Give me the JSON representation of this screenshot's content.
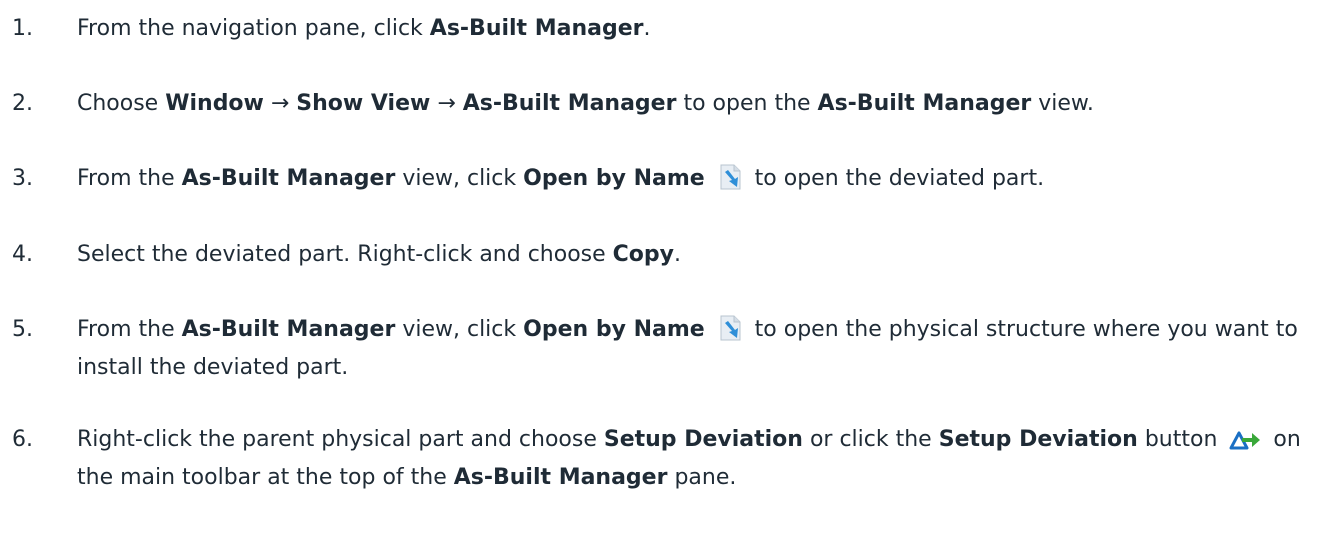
{
  "steps": [
    {
      "number": "1.",
      "parts": [
        {
          "t": "From the navigation pane, click "
        },
        {
          "t": "As-Built Manager",
          "b": true
        },
        {
          "t": "."
        }
      ]
    },
    {
      "number": "2.",
      "parts": [
        {
          "t": "Choose "
        },
        {
          "t": "Window",
          "b": true
        },
        {
          "t": " → "
        },
        {
          "t": "Show View",
          "b": true
        },
        {
          "t": " → "
        },
        {
          "t": "As-Built Manager",
          "b": true
        },
        {
          "t": " to open the "
        },
        {
          "t": "As-Built Manager",
          "b": true
        },
        {
          "t": " view."
        }
      ]
    },
    {
      "number": "3.",
      "parts": [
        {
          "t": "From the "
        },
        {
          "t": "As-Built Manager",
          "b": true
        },
        {
          "t": " view, click "
        },
        {
          "t": "Open by Name",
          "b": true
        },
        {
          "t": " "
        },
        {
          "icon": "open-by-name-icon"
        },
        {
          "t": " to open the deviated part."
        }
      ]
    },
    {
      "number": "4.",
      "parts": [
        {
          "t": "Select the deviated part. Right-click and choose "
        },
        {
          "t": "Copy",
          "b": true
        },
        {
          "t": "."
        }
      ]
    },
    {
      "number": "5.",
      "parts": [
        {
          "t": "From the "
        },
        {
          "t": "As-Built Manager",
          "b": true
        },
        {
          "t": " view, click "
        },
        {
          "t": "Open by Name",
          "b": true
        },
        {
          "t": " "
        },
        {
          "icon": "open-by-name-icon"
        },
        {
          "t": " to open the physical structure where you want to install the deviated part."
        }
      ]
    },
    {
      "number": "6.",
      "parts": [
        {
          "t": "Right-click the parent physical part and choose "
        },
        {
          "t": "Setup Deviation",
          "b": true
        },
        {
          "t": " or click the "
        },
        {
          "t": "Setup Deviation",
          "b": true
        },
        {
          "t": " button "
        },
        {
          "icon": "setup-deviation-icon"
        },
        {
          "t": " on the main toolbar at the top of the "
        },
        {
          "t": "As-Built Manager",
          "b": true
        },
        {
          "t": " pane."
        }
      ]
    }
  ],
  "icons": {
    "open-by-name-icon": {
      "page": "#e8eef4",
      "arrow": "#2f8fd8"
    },
    "setup-deviation-icon": {
      "triangle": "#1a6fc4",
      "arrow": "#3aa83a"
    }
  }
}
